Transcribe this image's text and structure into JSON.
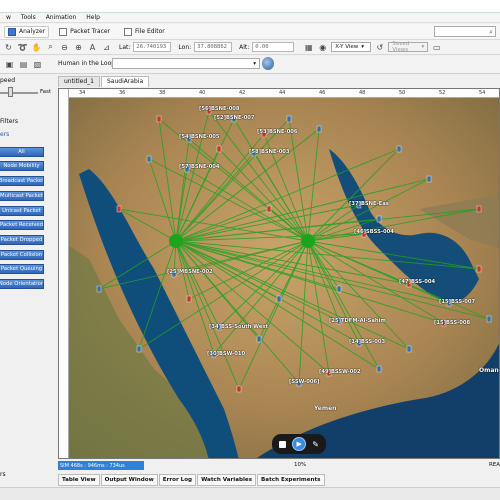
{
  "menu": [
    "w",
    "Tools",
    "Animation",
    "Help"
  ],
  "toolbar": {
    "analyzer": "Analyzer",
    "packet_tracer": "Packet Tracer",
    "file_editor": "File Editor"
  },
  "coords": {
    "lat_label": "Lat:",
    "lat_value": "26.740193",
    "lon_label": "Lon:",
    "lon_value": "37.808862",
    "alt_label": "Alt:",
    "alt_value": "0.00",
    "view_select": "X-Y View",
    "saved_views": "Saved Views"
  },
  "sidebar": {
    "speed_label": "peed",
    "fast_label": "Fast",
    "filters_heading": "Filters",
    "filters_sub": "ers",
    "filter_buttons": [
      "All",
      "Node Mobility",
      "Broadcast Packet",
      "Multicast Packet",
      "Unicast Packet",
      "Packet Received",
      "Packet Dropped",
      "Packet Collision",
      "Packet Queuing",
      "Node Orientation"
    ],
    "bottom_label": "rs"
  },
  "loop": {
    "label": "Human in the Loop:"
  },
  "tabs": [
    "untitled_1",
    "SaudiArabia"
  ],
  "map": {
    "ruler_top": [
      "34",
      "36",
      "38",
      "40",
      "42",
      "44",
      "46",
      "48",
      "50",
      "52",
      "54"
    ],
    "labels": [
      "[56]BSNE-008",
      "[52]BSNE-007",
      "[54]BSNE-005",
      "[53]BSNE-006",
      "[58]BSNE-003",
      "[57]BSNE-004",
      "[37]BSNE-Eas",
      "[46]SBSS-004",
      "[25]MBSNE-002",
      "[47]BSS-004",
      "[15]BSS-007",
      "[25]TDFM-Al-Sahim",
      "[15]BSS-008",
      "[34]BSS-South West",
      "[30]BSW-010",
      "[49]BSSW-002",
      "[SSW-006]",
      "[14]BSS-003",
      "Yemen",
      "Oman"
    ]
  },
  "player": {
    "stop": "stop",
    "play": "▶",
    "edit": "✎"
  },
  "status": {
    "sim_time": "SIM 468s : 946ms : 734us",
    "zoom": "10%",
    "right": "REA"
  },
  "bottom_tabs": [
    "Table View",
    "Output Window",
    "Error Log",
    "Watch Variables",
    "Batch Experiments"
  ]
}
